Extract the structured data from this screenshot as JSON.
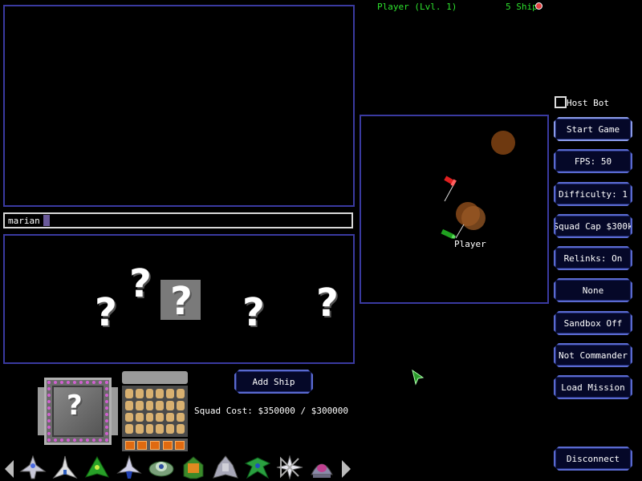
{
  "hud": {
    "player_level": "Player (Lvl. 1)",
    "ship_count": "5 Ship",
    "ship_count_icon": "red-ship-icon"
  },
  "chat": {
    "log": "",
    "input_value": "marian"
  },
  "minimap": {
    "player_label": "Player"
  },
  "host_bot": {
    "label": "Host Bot",
    "checked": false
  },
  "buttons": {
    "start_game": "Start Game",
    "fps": "FPS: 50",
    "difficulty": "Difficulty: 1",
    "squad_cap": "Squad Cap $300k",
    "relinks": "Relinks: On",
    "none": "None",
    "sandbox": "Sandbox Off",
    "commander": "Not Commander",
    "load_mission": "Load Mission",
    "disconnect": "Disconnect",
    "add_ship": "Add Ship"
  },
  "squad": {
    "slots": [
      "?",
      "?",
      "?",
      "?",
      "?"
    ],
    "selected_index": 2,
    "portrait_label": "?",
    "cost": "Squad Cost: $350000 / $300000"
  },
  "ship_bar": {
    "icons": [
      "fighter-ship-icon",
      "interceptor-ship-icon",
      "green-cruiser-ship-icon",
      "blue-fighter-ship-icon",
      "saucer-ship-icon",
      "green-orange-ship-icon",
      "frigate-ship-icon",
      "green-wing-ship-icon",
      "cross-star-ship-icon",
      "dome-ship-icon"
    ]
  },
  "colors": {
    "hud_green": "#2de02d",
    "panel_border": "#3a3aa0",
    "button_border": "#5a6ad0",
    "asteroid": "#8a4a1a"
  }
}
